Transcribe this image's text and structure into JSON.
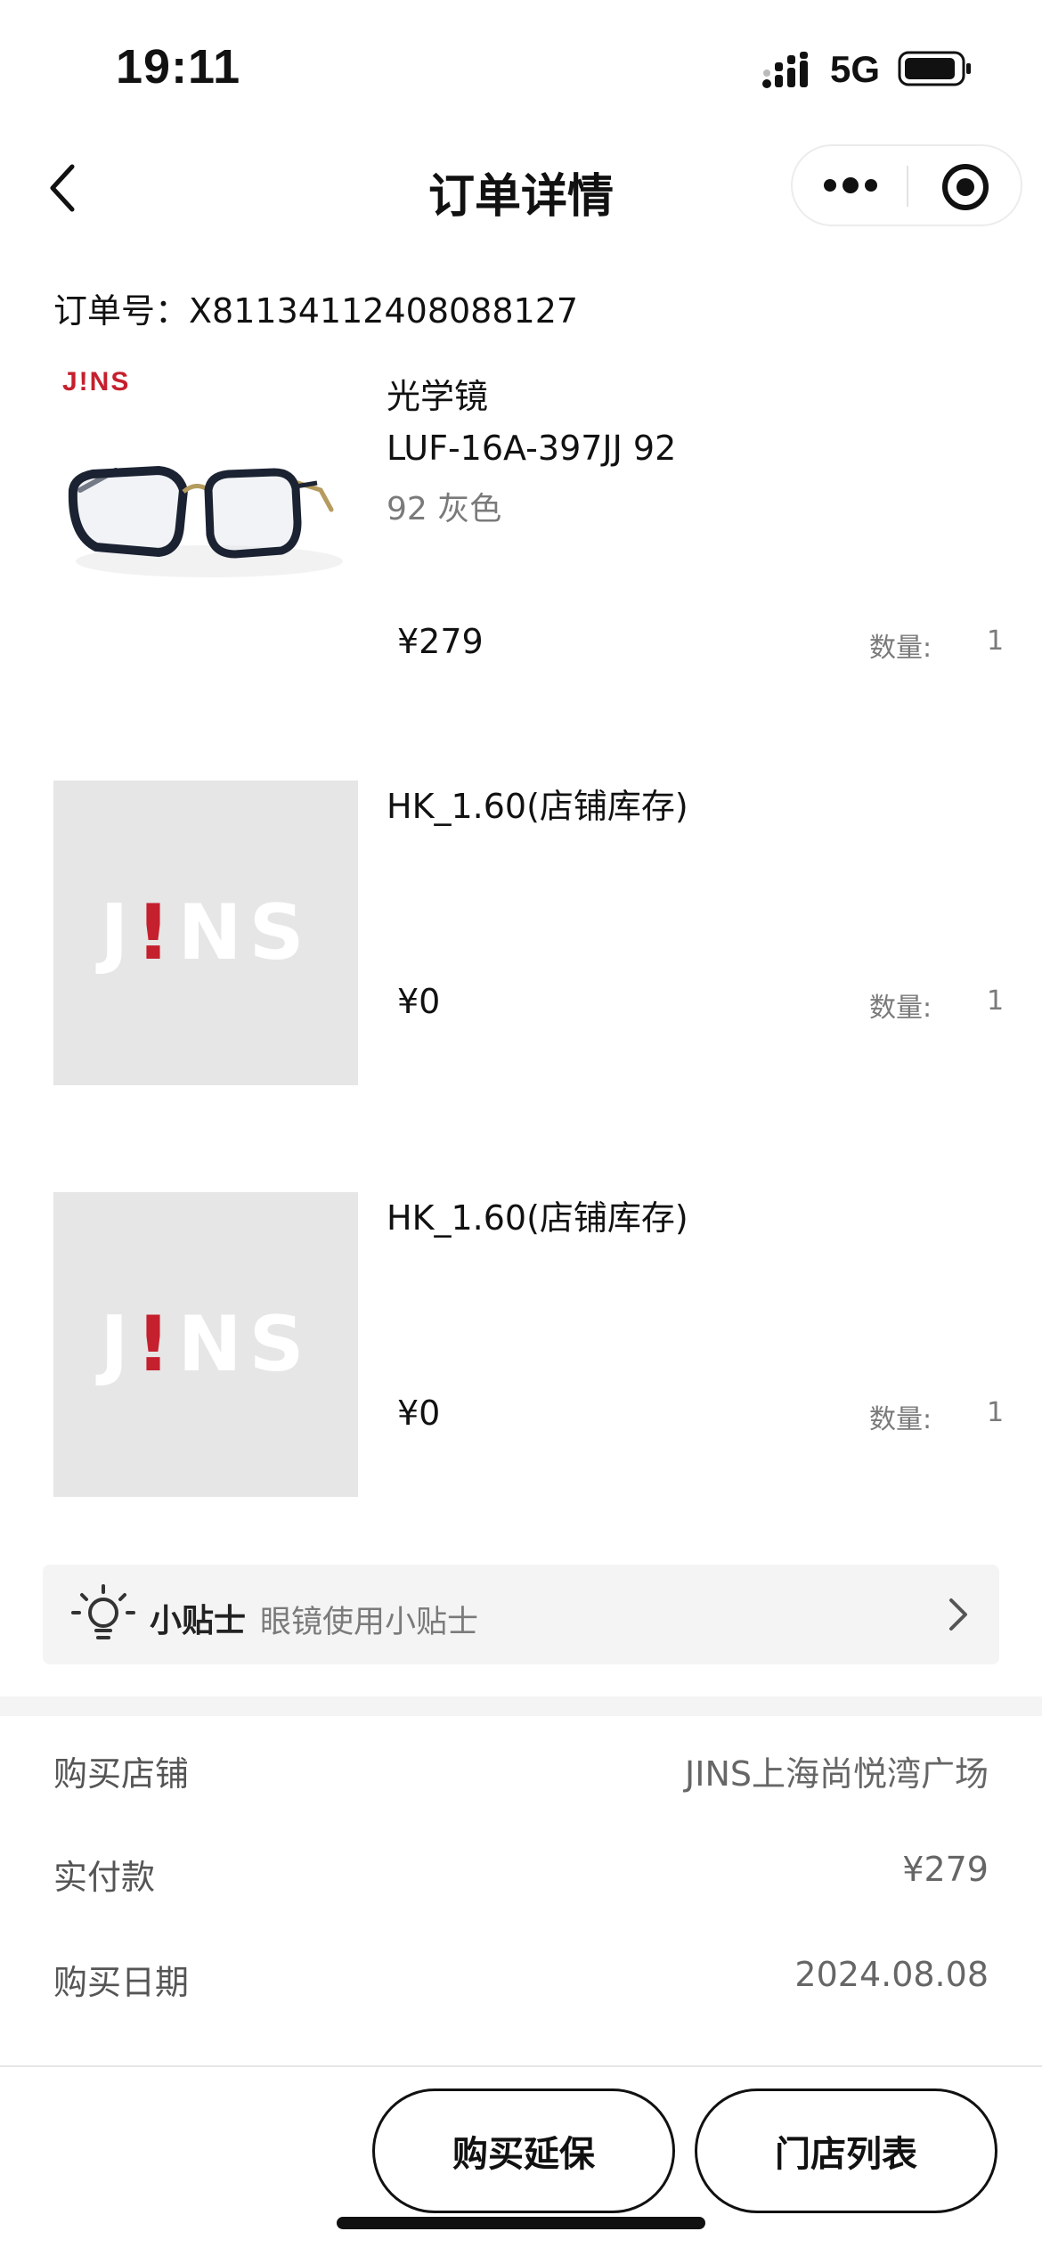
{
  "status_bar": {
    "time": "19:11",
    "network": "5G"
  },
  "nav": {
    "title": "订单详情",
    "back_icon": "chevron-left-icon",
    "more_icon": "more-dots-icon",
    "close_icon": "target-close-icon"
  },
  "order": {
    "number_label": "订单号：",
    "number": "X81134112408088127"
  },
  "products": [
    {
      "name_line1": "光学镜",
      "name_line2": "LUF-16A-397JJ 92",
      "variant": "92 灰色",
      "price": "¥279",
      "qty_label": "数量:",
      "qty": "1",
      "image": "glasses-photo",
      "brand": "J!NS"
    },
    {
      "name_line1": "HK_1.60(店铺库存)",
      "price": "¥0",
      "qty_label": "数量:",
      "qty": "1",
      "image": "jins-logo-placeholder"
    },
    {
      "name_line1": "HK_1.60(店铺库存)",
      "price": "¥0",
      "qty_label": "数量:",
      "qty": "1",
      "image": "jins-logo-placeholder"
    }
  ],
  "placeholder_logo": {
    "left": "J",
    "bang": "!",
    "right": "NS"
  },
  "tips": {
    "icon": "lightbulb-icon",
    "title": "小贴士",
    "text": "眼镜使用小贴士"
  },
  "info": [
    {
      "label": "购买店铺",
      "value": "JINS上海尚悦湾广场"
    },
    {
      "label": "实付款",
      "value": "¥279"
    },
    {
      "label": "购买日期",
      "value": "2024.08.08"
    }
  ],
  "buttons": {
    "extended_warranty": "购买延保",
    "store_list": "门店列表"
  },
  "colors": {
    "brand_red": "#c5202e",
    "placeholder_bg": "#e6e6e6",
    "tips_bg": "#f4f4f5"
  }
}
